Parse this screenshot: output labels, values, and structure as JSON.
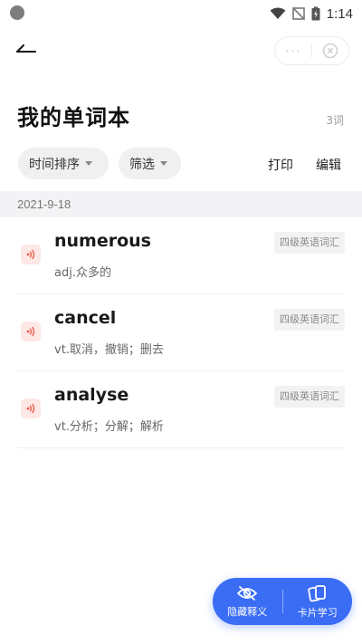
{
  "status_bar": {
    "time": "1:14"
  },
  "header": {
    "title": "我的单词本",
    "count": "3词",
    "more_label": "···"
  },
  "toolbar": {
    "sort_label": "时间排序",
    "filter_label": "筛选",
    "print_label": "打印",
    "edit_label": "编辑"
  },
  "list": {
    "date": "2021-9-18",
    "words": [
      {
        "word": "numerous",
        "meaning": "adj.众多的",
        "tag": "四级英语词汇"
      },
      {
        "word": "cancel",
        "meaning": "vt.取消，撤销；删去",
        "tag": "四级英语词汇"
      },
      {
        "word": "analyse",
        "meaning": "vt.分析；分解；解析",
        "tag": "四级英语词汇"
      }
    ]
  },
  "bottom_bar": {
    "hide_label": "隐藏释义",
    "card_label": "卡片学习"
  },
  "colors": {
    "accent": "#3a6cf4",
    "speaker": "#f05a4a"
  }
}
